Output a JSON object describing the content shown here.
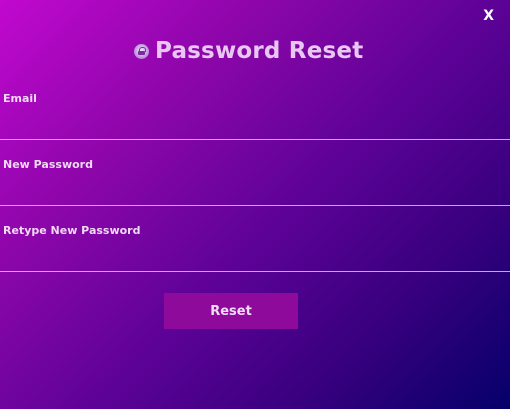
{
  "close": {
    "label": "X"
  },
  "header": {
    "title": "Password Reset",
    "icon": "lock-icon"
  },
  "form": {
    "email": {
      "label": "Email",
      "value": "",
      "placeholder": ""
    },
    "new_password": {
      "label": "New Password",
      "value": "",
      "placeholder": ""
    },
    "retype_password": {
      "label": "Retype New Password",
      "value": "",
      "placeholder": ""
    }
  },
  "actions": {
    "reset_label": "Reset"
  },
  "colors": {
    "gradient_start": "#c108cf",
    "gradient_end": "#05006a",
    "button": "#8e0a9a",
    "title": "#e9c6f3"
  }
}
